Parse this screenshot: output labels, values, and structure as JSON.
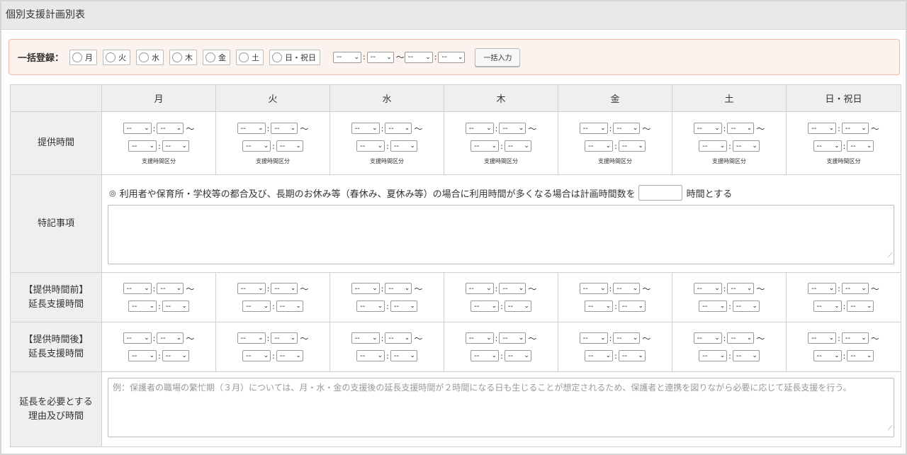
{
  "header": {
    "title": "個別支援計画別表"
  },
  "bulk": {
    "label": "一括登録：",
    "days": [
      "月",
      "火",
      "水",
      "木",
      "金",
      "土",
      "日・祝日"
    ],
    "time_start": {
      "hour": "--",
      "minute": "--"
    },
    "time_end": {
      "hour": "--",
      "minute": "--"
    },
    "range_separator": "～",
    "button_label": "一括入力"
  },
  "table": {
    "days": [
      "月",
      "火",
      "水",
      "木",
      "金",
      "土",
      "日・祝日"
    ],
    "rows": {
      "provide": {
        "label": "提供時間",
        "note": "支援時間区分"
      },
      "special": {
        "label": "特記事項",
        "note_mark": "◎",
        "note_text": "利用者や保育所・学校等の都合及び、長期のお休み等（春休み、夏休み等）の場合に利用時間が多くなる場合は計画時間数を",
        "note_suffix": "時間とする",
        "text_value": ""
      },
      "before": {
        "label_line1": "【提供時間前】",
        "label_line2": "延長支援時間"
      },
      "after": {
        "label_line1": "【提供時間後】",
        "label_line2": "延長支援時間"
      },
      "reason": {
        "label_line1": "延長を必要とする",
        "label_line2": "理由及び時間",
        "placeholder": "例：保護者の職場の繁忙期（３月）については、月・水・金の支援後の延長支援時間が２時間になる日も生じることが想定されるため、保護者と連携を図りながら必要に応じて延長支援を行う。"
      }
    },
    "select_value": "--",
    "colon": ":",
    "tilde": "～"
  }
}
